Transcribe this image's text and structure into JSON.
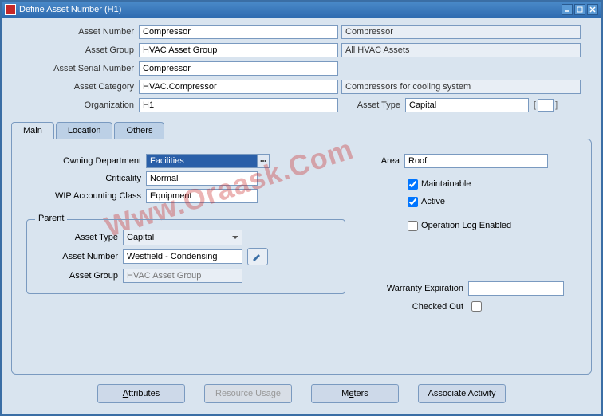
{
  "window": {
    "title": "Define Asset Number (H1)"
  },
  "top": {
    "asset_number_label": "Asset Number",
    "asset_number": "Compressor",
    "asset_number_desc": "Compressor",
    "asset_group_label": "Asset Group",
    "asset_group": "HVAC Asset Group",
    "asset_group_desc": "All HVAC Assets",
    "serial_label": "Asset Serial Number",
    "serial": "Compressor",
    "category_label": "Asset Category",
    "category": "HVAC.Compressor",
    "category_desc": "Compressors for cooling system",
    "org_label": "Organization",
    "org": "H1",
    "asset_type_label": "Asset Type",
    "asset_type": "Capital"
  },
  "tabs": {
    "main": "Main",
    "location": "Location",
    "others": "Others"
  },
  "main": {
    "owning_dept_label": "Owning Department",
    "owning_dept": "Facilities",
    "criticality_label": "Criticality",
    "criticality": "Normal",
    "wip_label": "WIP Accounting Class",
    "wip": "Equipment",
    "area_label": "Area",
    "area": "Roof",
    "maintainable_label": "Maintainable",
    "active_label": "Active",
    "oplog_label": "Operation Log Enabled",
    "parent_legend": "Parent",
    "parent_asset_type_label": "Asset Type",
    "parent_asset_type": "Capital",
    "parent_asset_number_label": "Asset Number",
    "parent_asset_number": "Westfield - Condensing",
    "parent_asset_group_label": "Asset Group",
    "parent_asset_group": "HVAC Asset Group",
    "warranty_label": "Warranty Expiration",
    "checked_out_label": "Checked Out"
  },
  "buttons": {
    "attributes": "Attributes",
    "resource_usage": "Resource Usage",
    "meters": "Meters",
    "associate_activity": "Associate Activity"
  },
  "watermark": "Www.Oraask.Com"
}
